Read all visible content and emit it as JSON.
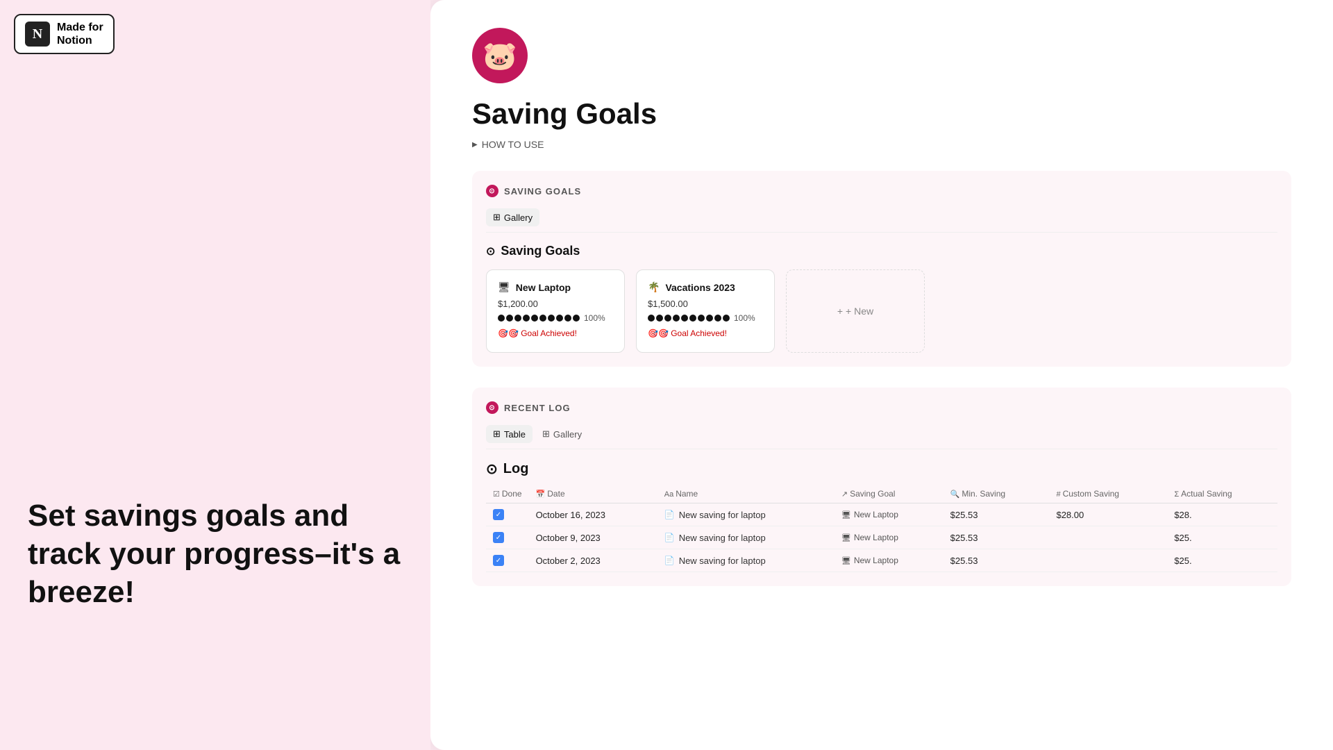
{
  "badge": {
    "icon_char": "N",
    "line1": "Made for",
    "line2": "Notion"
  },
  "tagline": "Set savings goals and track your progress–it's a breeze!",
  "page": {
    "icon": "🐷",
    "title": "Saving Goals",
    "how_to_use": "HOW TO USE"
  },
  "saving_goals_section": {
    "label": "SAVING GOALS",
    "view_tabs": [
      {
        "label": "Gallery",
        "icon": "⊞",
        "active": true
      }
    ],
    "sub_heading": "Saving Goals",
    "new_button": "+ New",
    "cards": [
      {
        "icon": "🖥",
        "title": "New Laptop",
        "amount": "$1,200.00",
        "progress_pct": "100%",
        "dots": 10,
        "achievement": "🎯🎯 Goal Achieved!"
      },
      {
        "icon": "🌴",
        "title": "Vacations 2023",
        "amount": "$1,500.00",
        "progress_pct": "100%",
        "dots": 10,
        "achievement": "🎯🎯 Goal Achieved!"
      }
    ]
  },
  "recent_log_section": {
    "label": "RECENT LOG",
    "view_tabs": [
      {
        "label": "Table",
        "icon": "⊞",
        "active": true
      },
      {
        "label": "Gallery",
        "icon": "⊞",
        "active": false
      }
    ],
    "log_heading": "Log",
    "columns": [
      "Done",
      "Date",
      "Name",
      "Saving Goal",
      "Min. Saving",
      "Custom Saving",
      "Actual Saving"
    ],
    "rows": [
      {
        "done": true,
        "date": "October 16, 2023",
        "name": "New saving for laptop",
        "saving_goal": "New Laptop",
        "min_saving": "$25.53",
        "custom_saving": "$28.00",
        "actual_saving": "$28."
      },
      {
        "done": true,
        "date": "October 9, 2023",
        "name": "New saving for laptop",
        "saving_goal": "New Laptop",
        "min_saving": "$25.53",
        "custom_saving": "",
        "actual_saving": "$25."
      },
      {
        "done": true,
        "date": "October 2, 2023",
        "name": "New saving for laptop",
        "saving_goal": "New Laptop",
        "min_saving": "$25.53",
        "custom_saving": "",
        "actual_saving": "$25."
      }
    ]
  },
  "colors": {
    "accent": "#c2185b",
    "bg": "#fce8f0",
    "page_bg": "#ffffff"
  }
}
